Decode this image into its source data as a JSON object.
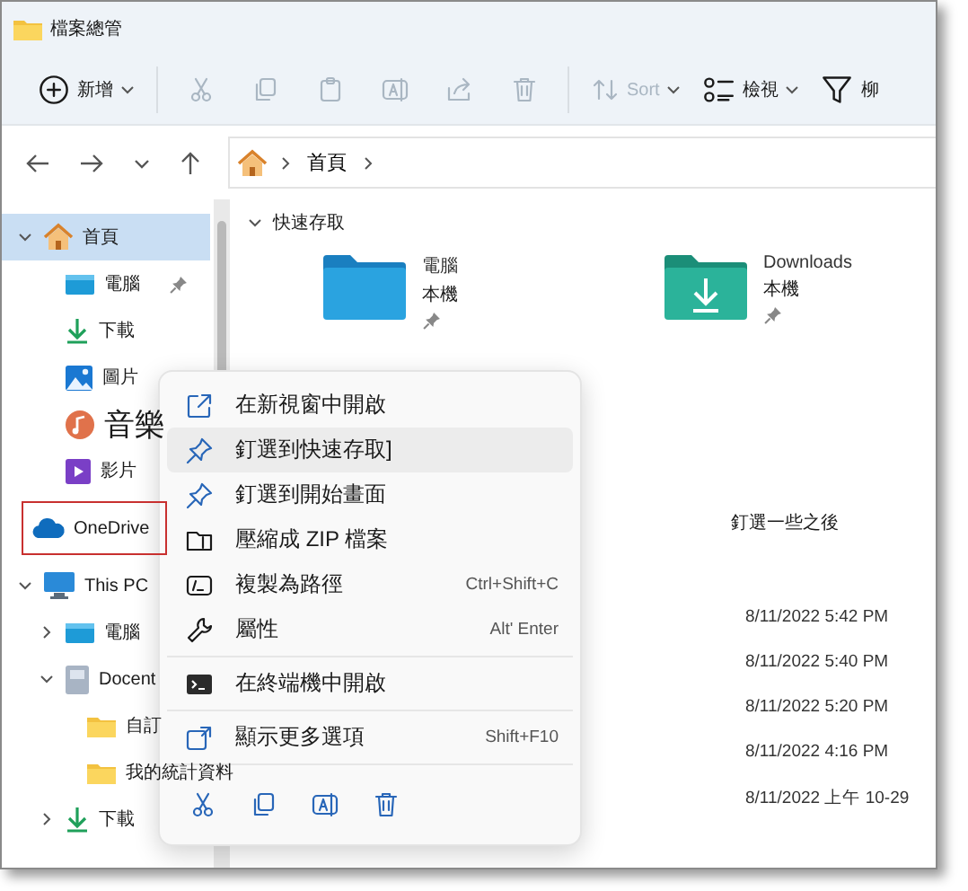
{
  "window": {
    "title": "檔案總管"
  },
  "toolbar": [
    {
      "kind": "new",
      "label": "新增",
      "dropdown": true,
      "disabled": false
    },
    {
      "kind": "cut",
      "disabled": true
    },
    {
      "kind": "copy",
      "disabled": true
    },
    {
      "kind": "paste",
      "disabled": true
    },
    {
      "kind": "rename",
      "disabled": true
    },
    {
      "kind": "share",
      "disabled": true
    },
    {
      "kind": "delete",
      "disabled": true
    },
    {
      "kind": "sort",
      "label": "Sort",
      "dropdown": true,
      "disabled": true
    },
    {
      "kind": "view",
      "label": "檢視",
      "dropdown": true,
      "disabled": false
    },
    {
      "kind": "filter",
      "label": "柳",
      "disabled": false
    }
  ],
  "address": {
    "crumbs": [
      "首頁"
    ]
  },
  "sidebar": {
    "items": [
      {
        "label": "首頁",
        "kind": "home",
        "expanded": true,
        "selected": true,
        "children": [
          {
            "label": "電腦",
            "kind": "desktop",
            "pinned": true,
            "selected": false
          },
          {
            "label": "下載",
            "kind": "download",
            "selected": false
          },
          {
            "label": "圖片",
            "kind": "pictures",
            "selected": false
          },
          {
            "label": "音樂",
            "kind": "music",
            "selected": false,
            "large": true
          },
          {
            "label": "影片",
            "kind": "videos",
            "selected": false
          }
        ]
      },
      {
        "label": "OneDrive",
        "kind": "cloud",
        "selected": false,
        "outlined": true
      },
      {
        "label": "This PC",
        "kind": "pc",
        "expanded": true,
        "selected": false,
        "children": [
          {
            "label": "電腦",
            "kind": "desktop",
            "expanded": false,
            "selected": false
          },
          {
            "label": "Docent",
            "kind": "drive",
            "expanded": true,
            "selected": false,
            "children": [
              {
                "label": "自訂",
                "kind": "folder",
                "selected": false
              },
              {
                "label": "我的統計資料",
                "kind": "folder",
                "selected": false
              }
            ]
          },
          {
            "label": "下載",
            "kind": "download",
            "expanded": false,
            "selected": false
          }
        ]
      }
    ]
  },
  "quick_access": {
    "header": "快速存取",
    "expanded": true,
    "tiles": [
      {
        "name": "電腦",
        "location": "本機",
        "kind": "desktop",
        "pinned": true
      },
      {
        "name": "Downloads",
        "location": "本機",
        "kind": "download",
        "pinned": true
      }
    ]
  },
  "recent": {
    "message": "釘選一些之後",
    "dates": [
      "8/11/2022 5:42 PM",
      "8/11/2022 5:40 PM",
      "8/11/2022 5:20 PM",
      "8/11/2022 4:16 PM",
      "8/11/2022 上午 10-29"
    ]
  },
  "context_menu": {
    "sections": [
      [
        {
          "kind": "open-new",
          "label": "在新視窗中開啟",
          "highlighted": false
        },
        {
          "kind": "pin",
          "label": "釘選到快速存取]",
          "highlighted": true
        },
        {
          "kind": "pin",
          "label": "釘選到開始畫面",
          "highlighted": false
        },
        {
          "kind": "zip",
          "label": "壓縮成 ZIP 檔案",
          "highlighted": false
        },
        {
          "kind": "path",
          "label": "複製為路徑",
          "shortcut": "Ctrl+Shift+C",
          "highlighted": false
        },
        {
          "kind": "wrench",
          "label": "屬性",
          "shortcut": "Alt' Enter",
          "highlighted": false
        }
      ],
      [
        {
          "kind": "terminal",
          "label": "在終端機中開啟",
          "highlighted": false
        }
      ],
      [
        {
          "kind": "more",
          "label": "顯示更多選項",
          "shortcut": "Shift+F10",
          "highlighted": false
        }
      ]
    ],
    "actions": [
      {
        "kind": "cut"
      },
      {
        "kind": "copy"
      },
      {
        "kind": "rename"
      },
      {
        "kind": "delete"
      }
    ]
  }
}
